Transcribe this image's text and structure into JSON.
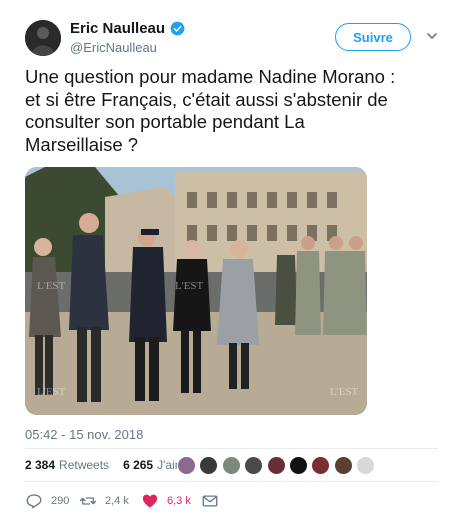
{
  "author": {
    "name": "Eric Naulleau",
    "handle": "@EricNaulleau",
    "verified": true,
    "icons": {
      "verified": "verified-badge-icon",
      "menu": "chevron-down-icon"
    }
  },
  "follow_button": {
    "label": "Suivre"
  },
  "tweet": {
    "text_lines": [
      "Une question pour madame Nadine Morano :",
      "et si être Français, c'était aussi s'abstenir de",
      "consulter son portable pendant La",
      "Marseillaise ?"
    ],
    "timestamp": "05:42 - 15 nov. 2018",
    "media_watermark": "L'EST"
  },
  "stats": {
    "retweets_count": "2 384",
    "retweets_label": "Retweets",
    "likes_count": "6 265",
    "likes_label": "J'aime",
    "liker_avatar_colors": [
      "#8a6b8f",
      "#3a3a3a",
      "#7b8a7a",
      "#4a4a4a",
      "#6a2e3a",
      "#111111",
      "#7a3030",
      "#5a4030",
      "#d8d8d8"
    ]
  },
  "actions": {
    "reply": {
      "icon": "reply-icon",
      "count": "290"
    },
    "retweet": {
      "icon": "retweet-icon",
      "count": "2,4 k"
    },
    "like": {
      "icon": "heart-icon",
      "count": "6,3 k"
    },
    "message": {
      "icon": "envelope-icon"
    }
  },
  "colors": {
    "accent": "#1da1f2",
    "like": "#e0245e",
    "muted": "#657786"
  }
}
